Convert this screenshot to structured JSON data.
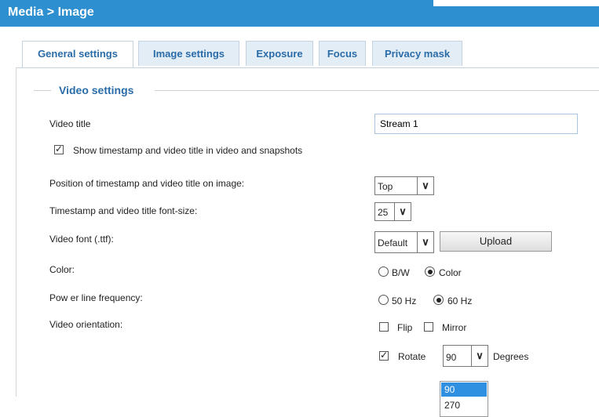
{
  "header": {
    "title": "Media > Image"
  },
  "tabs": [
    {
      "label": "General settings"
    },
    {
      "label": "Image settings"
    },
    {
      "label": "Exposure"
    },
    {
      "label": "Focus"
    },
    {
      "label": "Privacy mask"
    }
  ],
  "group": {
    "title": "Video settings"
  },
  "video_title": {
    "label": "Video title",
    "value": "Stream 1"
  },
  "show_timestamp": {
    "label": "Show timestamp and video title in video and snapshots",
    "checked": true
  },
  "position": {
    "label": "Position of timestamp and video title on image:",
    "selected": "Top"
  },
  "font_size": {
    "label": "Timestamp and video title font-size:",
    "selected": "25"
  },
  "video_font": {
    "label": "Video font (.ttf):",
    "selected": "Default",
    "upload_label": "Upload"
  },
  "color": {
    "label": "Color:",
    "options": [
      "B/W",
      "Color"
    ],
    "selected": "Color"
  },
  "power_line": {
    "label": "Pow er line frequency:",
    "options": [
      "50 Hz",
      "60 Hz"
    ],
    "selected": "60 Hz"
  },
  "orientation": {
    "label": "Video orientation:",
    "flip_label": "Flip",
    "mirror_label": "Mirror",
    "rotate_label": "Rotate",
    "rotate_selected": "90",
    "degrees_label": "Degrees",
    "rotate_options": [
      "90",
      "270"
    ]
  }
}
